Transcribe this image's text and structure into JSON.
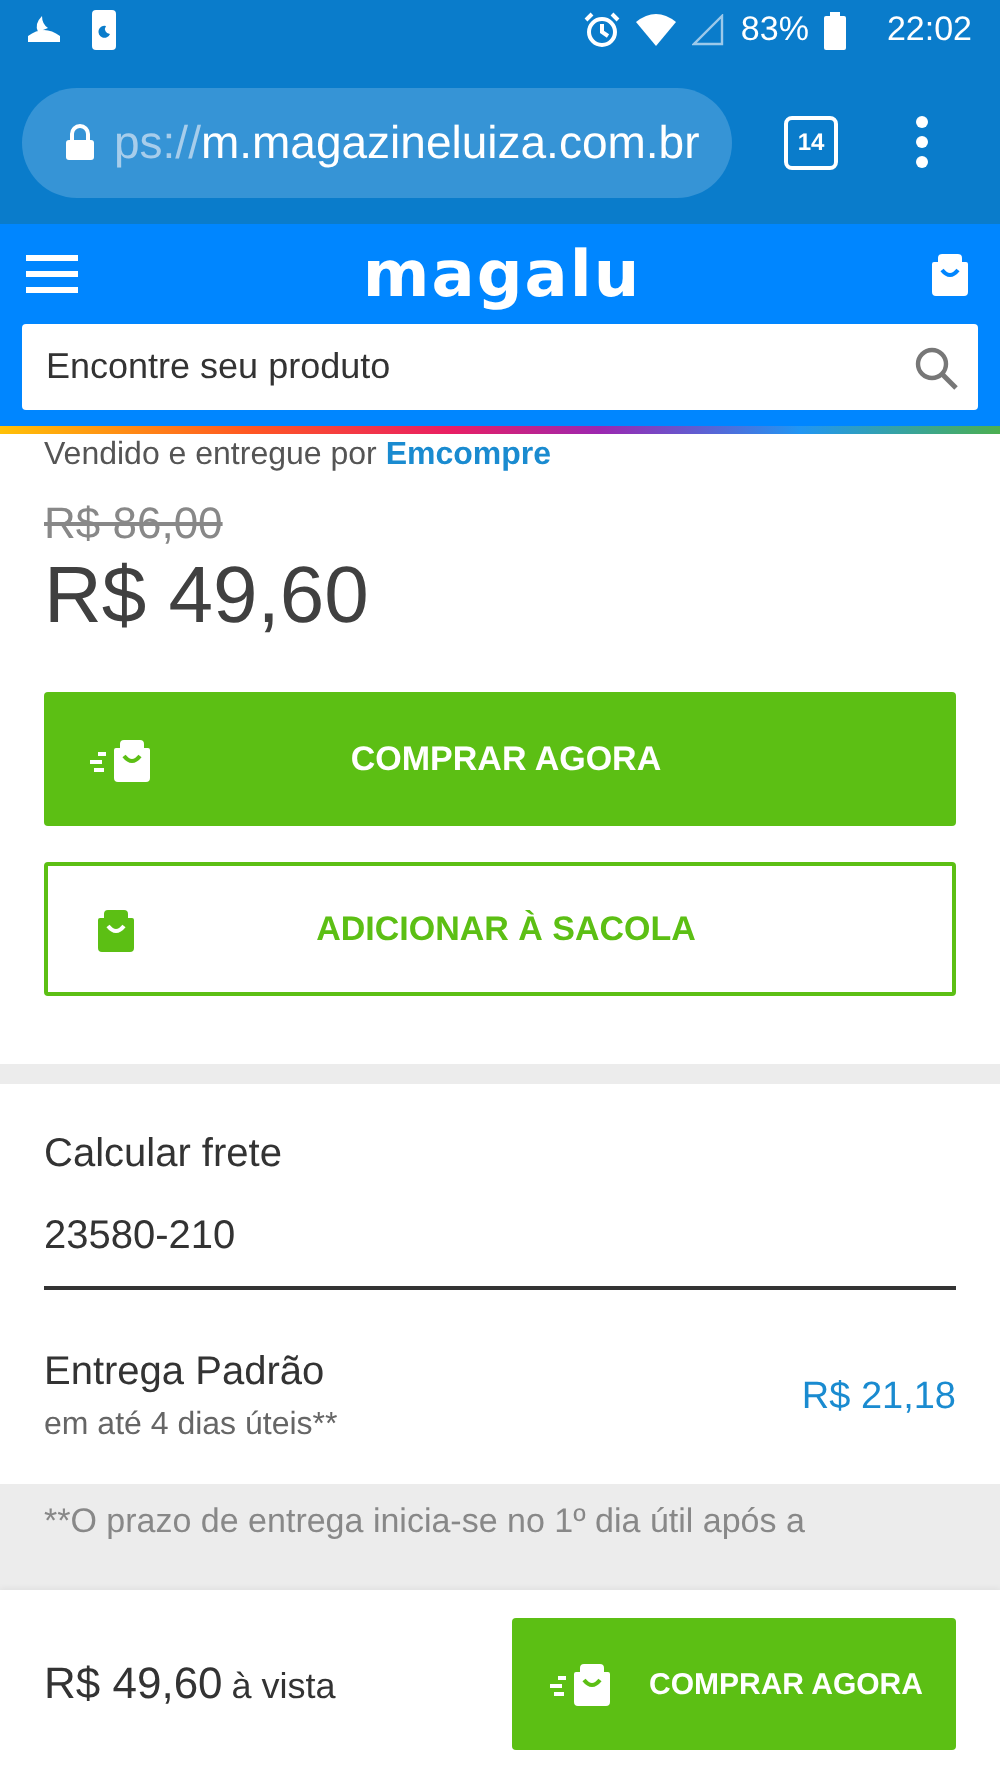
{
  "status_bar": {
    "battery": "83%",
    "time": "22:02"
  },
  "browser": {
    "url_scheme": "ps://",
    "url_host": "m.magazineluiza.com.br",
    "tab_count": "14"
  },
  "header": {
    "logo": "magalu",
    "search": {
      "placeholder": "Encontre seu produto"
    }
  },
  "product": {
    "seller_prefix": "Vendido e entregue por",
    "seller": "Emcompre",
    "old_price": "R$ 86,00",
    "price": "R$ 49,60",
    "buttons": [
      {
        "kind": "primary",
        "label": "COMPRAR AGORA"
      },
      {
        "kind": "outline",
        "label": "ADICIONAR À SACOLA"
      }
    ]
  },
  "freight": {
    "title": "Calcular frete",
    "cep": "23580-210",
    "option": {
      "name": "Entrega Padrão",
      "eta": "em até 4 dias úteis**",
      "price": "R$ 21,18"
    },
    "note": "**O prazo de entrega inicia-se no 1º dia útil após a"
  },
  "sticky_bar": {
    "price": "R$ 49,60",
    "suffix": "à vista",
    "button": "COMPRAR AGORA"
  }
}
